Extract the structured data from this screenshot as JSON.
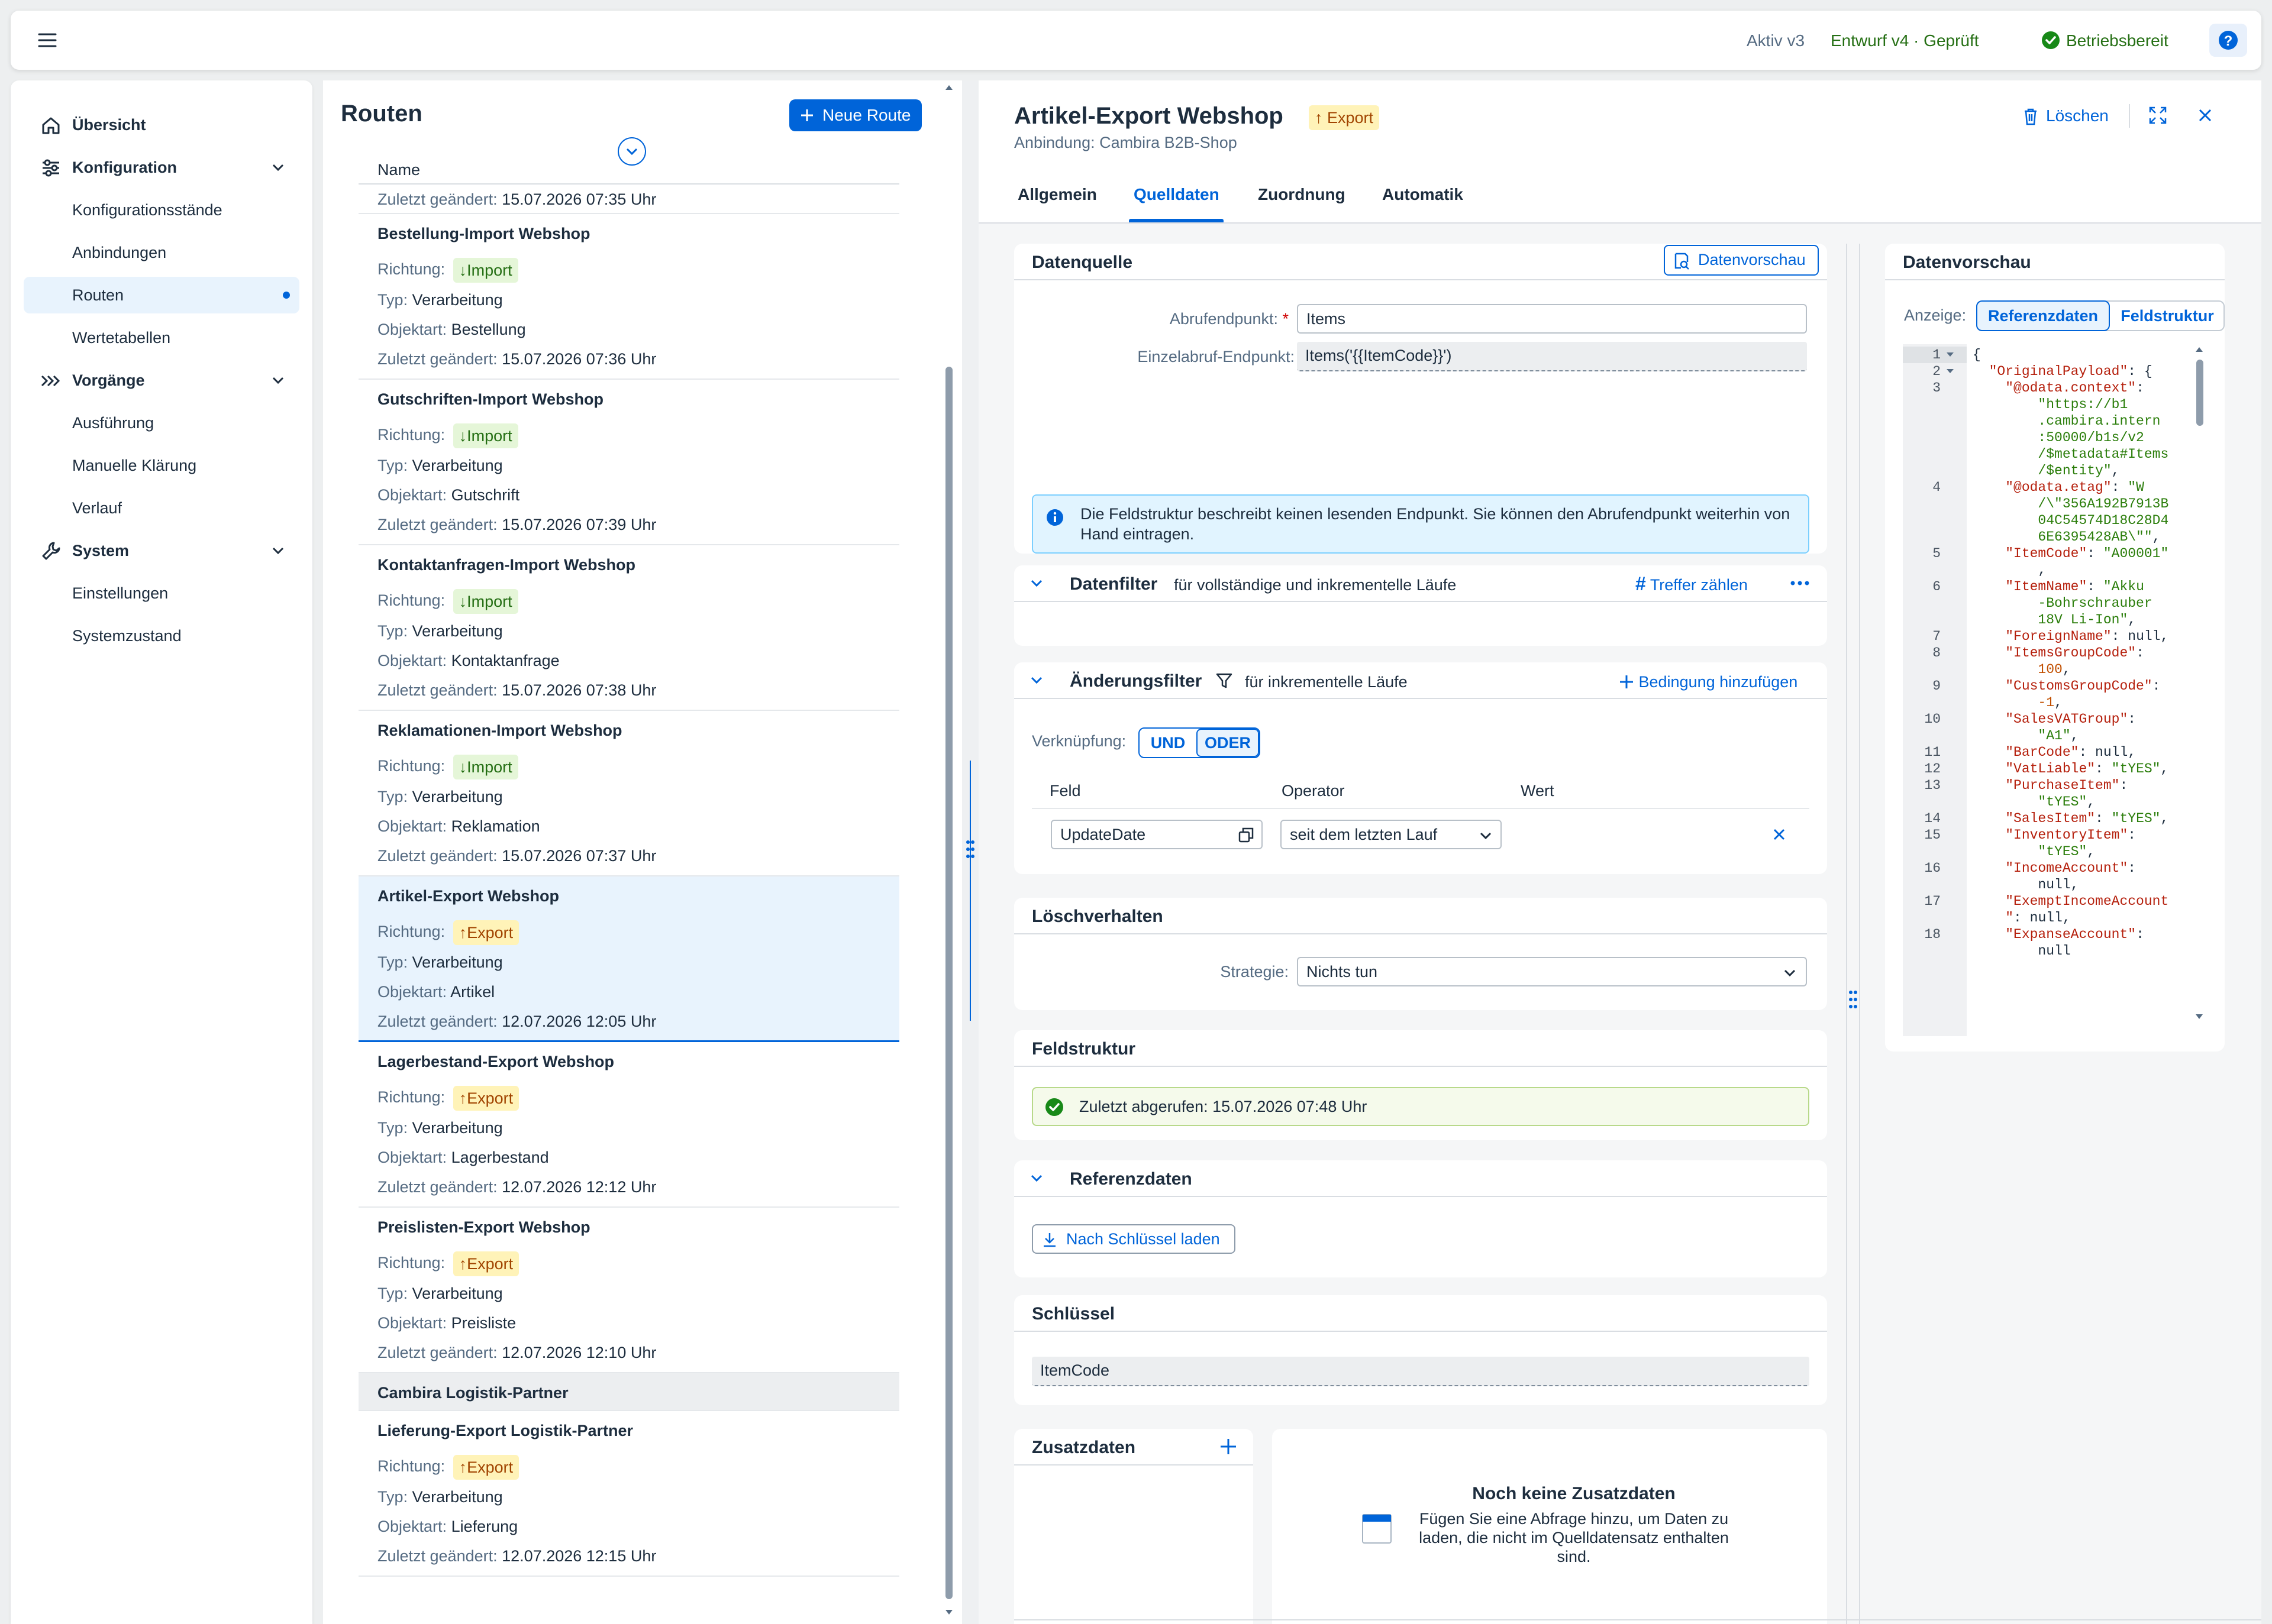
{
  "topbar": {
    "active_version": "Aktiv v3",
    "draft_version": "Entwurf v4 · Geprüft",
    "status": "Betriebsbereit"
  },
  "nav": {
    "items": [
      {
        "label": "Übersicht",
        "icon": "home-icon",
        "level": 0
      },
      {
        "label": "Konfiguration",
        "icon": "settings-sliders-icon",
        "level": 0
      },
      {
        "label": "Konfigurationsstände",
        "level": 1
      },
      {
        "label": "Anbindungen",
        "level": 1
      },
      {
        "label": "Routen",
        "level": 1,
        "selected": true
      },
      {
        "label": "Wertetabellen",
        "level": 1
      },
      {
        "label": "Vorgänge",
        "icon": "process-arrows-icon",
        "level": 0
      },
      {
        "label": "Ausführung",
        "level": 1
      },
      {
        "label": "Manuelle Klärung",
        "level": 1
      },
      {
        "label": "Verlauf",
        "level": 1
      },
      {
        "label": "System",
        "icon": "wrench-icon",
        "level": 0
      },
      {
        "label": "Einstellungen",
        "level": 1
      },
      {
        "label": "Systemzustand",
        "level": 1
      }
    ]
  },
  "routes": {
    "title": "Routen",
    "new_button": "Neue Route",
    "column_header": "Name",
    "labels": {
      "direction": "Richtung:",
      "type": "Typ:",
      "object": "Objektart:",
      "changed": "Zuletzt geändert:"
    },
    "first_row_changed": "15.07.2026 07:35 Uhr",
    "items": [
      {
        "name": "Bestellung-Import Webshop",
        "direction": "Import",
        "type": "Verarbeitung",
        "object": "Bestellung",
        "changed": "15.07.2026 07:36 Uhr"
      },
      {
        "name": "Gutschriften-Import Webshop",
        "direction": "Import",
        "type": "Verarbeitung",
        "object": "Gutschrift",
        "changed": "15.07.2026 07:39 Uhr"
      },
      {
        "name": "Kontaktanfragen-Import Webshop",
        "direction": "Import",
        "type": "Verarbeitung",
        "object": "Kontaktanfrage",
        "changed": "15.07.2026 07:38 Uhr"
      },
      {
        "name": "Reklamationen-Import Webshop",
        "direction": "Import",
        "type": "Verarbeitung",
        "object": "Reklamation",
        "changed": "15.07.2026 07:37 Uhr"
      },
      {
        "name": "Artikel-Export Webshop",
        "direction": "Export",
        "type": "Verarbeitung",
        "object": "Artikel",
        "changed": "12.07.2026 12:05 Uhr",
        "selected": true
      },
      {
        "name": "Lagerbestand-Export Webshop",
        "direction": "Export",
        "type": "Verarbeitung",
        "object": "Lagerbestand",
        "changed": "12.07.2026 12:12 Uhr"
      },
      {
        "name": "Preislisten-Export Webshop",
        "direction": "Export",
        "type": "Verarbeitung",
        "object": "Preisliste",
        "changed": "12.07.2026 12:10 Uhr"
      }
    ],
    "group_header": "Cambira Logistik-Partner",
    "group_items": [
      {
        "name": "Lieferung-Export Logistik-Partner",
        "direction": "Export",
        "type": "Verarbeitung",
        "object": "Lieferung",
        "changed": "12.07.2026 12:15 Uhr"
      }
    ]
  },
  "detail": {
    "title": "Artikel-Export Webshop",
    "direction_badge": "Export",
    "subtitle": "Anbindung: Cambira B2B-Shop",
    "delete_button": "Löschen",
    "tabs": [
      "Allgemein",
      "Quelldaten",
      "Zuordnung",
      "Automatik"
    ],
    "active_tab": "Quelldaten",
    "datasource": {
      "title": "Datenquelle",
      "preview_button": "Datenvorschau",
      "endpoint_label": "Abrufendpunkt:",
      "endpoint_value": "Items",
      "single_label": "Einzelabruf-Endpunkt:",
      "single_value": "Items('{{ItemCode}}')",
      "info": "Die Feldstruktur beschreibt keinen lesenden Endpunkt. Sie können den Abrufendpunkt weiterhin von Hand eintragen."
    },
    "datafilter": {
      "title": "Datenfilter",
      "subtitle": "für vollständige und inkrementelle Läufe",
      "action": "Treffer zählen"
    },
    "changefilter": {
      "title": "Änderungsfilter",
      "subtitle": "für inkrementelle Läufe",
      "action": "Bedingung hinzufügen",
      "link_label": "Verknüpfung:",
      "toggle": [
        "UND",
        "ODER"
      ],
      "active_toggle": "ODER",
      "headers": [
        "Feld",
        "Operator",
        "Wert"
      ],
      "field": "UpdateDate",
      "operator": "seit dem letzten Lauf"
    },
    "delete_behavior": {
      "title": "Löschverhalten",
      "strategy_label": "Strategie:",
      "strategy": "Nichts tun"
    },
    "fieldstructure": {
      "title": "Feldstruktur",
      "status": "Zuletzt abgerufen: 15.07.2026 07:48 Uhr"
    },
    "referencedata": {
      "title": "Referenzdaten",
      "button": "Nach Schlüssel laden"
    },
    "key": {
      "title": "Schlüssel",
      "value": "ItemCode"
    },
    "extradata": {
      "title": "Zusatzdaten",
      "empty_title": "Noch keine Zusatzdaten",
      "empty_text": "Fügen Sie eine Abfrage hinzu, um Daten zu laden, die nicht im Quelldatensatz enthalten sind."
    },
    "preview": {
      "title": "Datenvorschau",
      "display_label": "Anzeige:",
      "options": [
        "Referenzdaten",
        "Feldstruktur"
      ],
      "active_option": "Referenzdaten",
      "lines": [
        {
          "n": "1",
          "fold": true,
          "t": [
            [
              "p",
              "{"
            ]
          ]
        },
        {
          "n": "2",
          "fold": true,
          "t": [
            [
              "p",
              "  "
            ],
            [
              "k",
              "\"OriginalPayload\""
            ],
            [
              "p",
              ": {"
            ]
          ]
        },
        {
          "n": "3",
          "t": [
            [
              "p",
              "    "
            ],
            [
              "k",
              "\"@odata.context\""
            ],
            [
              "p",
              ":"
            ]
          ]
        },
        {
          "t": [
            [
              "p",
              "        "
            ],
            [
              "v",
              "\"https://b1"
            ]
          ]
        },
        {
          "t": [
            [
              "p",
              "        "
            ],
            [
              "v",
              ".cambira.intern"
            ]
          ]
        },
        {
          "t": [
            [
              "p",
              "        "
            ],
            [
              "v",
              ":50000/b1s/v2"
            ]
          ]
        },
        {
          "t": [
            [
              "p",
              "        "
            ],
            [
              "v",
              "/$metadata#Items"
            ]
          ]
        },
        {
          "t": [
            [
              "p",
              "        "
            ],
            [
              "v",
              "/$entity\""
            ],
            [
              "p",
              ","
            ]
          ]
        },
        {
          "n": "4",
          "t": [
            [
              "p",
              "    "
            ],
            [
              "k",
              "\"@odata.etag\""
            ],
            [
              "p",
              ": "
            ],
            [
              "v",
              "\"W"
            ]
          ]
        },
        {
          "t": [
            [
              "p",
              "        "
            ],
            [
              "v",
              "/\\\"356A192B7913B"
            ]
          ]
        },
        {
          "t": [
            [
              "p",
              "        "
            ],
            [
              "v",
              "04C54574D18C28D4"
            ]
          ]
        },
        {
          "t": [
            [
              "p",
              "        "
            ],
            [
              "v",
              "6E6395428AB\\\"\""
            ],
            [
              "p",
              ","
            ]
          ]
        },
        {
          "n": "5",
          "t": [
            [
              "p",
              "    "
            ],
            [
              "k",
              "\"ItemCode\""
            ],
            [
              "p",
              ": "
            ],
            [
              "v",
              "\"A00001\""
            ]
          ]
        },
        {
          "t": [
            [
              "p",
              "        ,"
            ]
          ]
        },
        {
          "n": "6",
          "t": [
            [
              "p",
              "    "
            ],
            [
              "k",
              "\"ItemName\""
            ],
            [
              "p",
              ": "
            ],
            [
              "v",
              "\"Akku"
            ]
          ]
        },
        {
          "t": [
            [
              "p",
              "        "
            ],
            [
              "v",
              "-Bohrschrauber"
            ]
          ]
        },
        {
          "t": [
            [
              "p",
              "        "
            ],
            [
              "v",
              "18V Li-Ion\""
            ],
            [
              "p",
              ","
            ]
          ]
        },
        {
          "n": "7",
          "t": [
            [
              "p",
              "    "
            ],
            [
              "k",
              "\"ForeignName\""
            ],
            [
              "p",
              ": null,"
            ]
          ]
        },
        {
          "n": "8",
          "t": [
            [
              "p",
              "    "
            ],
            [
              "k",
              "\"ItemsGroupCode\""
            ],
            [
              "p",
              ":"
            ]
          ]
        },
        {
          "t": [
            [
              "p",
              "        "
            ],
            [
              "n",
              "100"
            ],
            [
              "p",
              ","
            ]
          ]
        },
        {
          "n": "9",
          "t": [
            [
              "p",
              "    "
            ],
            [
              "k",
              "\"CustomsGroupCode\""
            ],
            [
              "p",
              ":"
            ]
          ]
        },
        {
          "t": [
            [
              "p",
              "        "
            ],
            [
              "n",
              "-1"
            ],
            [
              "p",
              ","
            ]
          ]
        },
        {
          "n": "10",
          "t": [
            [
              "p",
              "    "
            ],
            [
              "k",
              "\"SalesVATGroup\""
            ],
            [
              "p",
              ":"
            ]
          ]
        },
        {
          "t": [
            [
              "p",
              "        "
            ],
            [
              "v",
              "\"A1\""
            ],
            [
              "p",
              ","
            ]
          ]
        },
        {
          "n": "11",
          "t": [
            [
              "p",
              "    "
            ],
            [
              "k",
              "\"BarCode\""
            ],
            [
              "p",
              ": null,"
            ]
          ]
        },
        {
          "n": "12",
          "t": [
            [
              "p",
              "    "
            ],
            [
              "k",
              "\"VatLiable\""
            ],
            [
              "p",
              ": "
            ],
            [
              "v",
              "\"tYES\""
            ],
            [
              "p",
              ","
            ]
          ]
        },
        {
          "n": "13",
          "t": [
            [
              "p",
              "    "
            ],
            [
              "k",
              "\"PurchaseItem\""
            ],
            [
              "p",
              ":"
            ]
          ]
        },
        {
          "t": [
            [
              "p",
              "        "
            ],
            [
              "v",
              "\"tYES\""
            ],
            [
              "p",
              ","
            ]
          ]
        },
        {
          "n": "14",
          "t": [
            [
              "p",
              "    "
            ],
            [
              "k",
              "\"SalesItem\""
            ],
            [
              "p",
              ": "
            ],
            [
              "v",
              "\"tYES\""
            ],
            [
              "p",
              ","
            ]
          ]
        },
        {
          "n": "15",
          "t": [
            [
              "p",
              "    "
            ],
            [
              "k",
              "\"InventoryItem\""
            ],
            [
              "p",
              ":"
            ]
          ]
        },
        {
          "t": [
            [
              "p",
              "        "
            ],
            [
              "v",
              "\"tYES\""
            ],
            [
              "p",
              ","
            ]
          ]
        },
        {
          "n": "16",
          "t": [
            [
              "p",
              "    "
            ],
            [
              "k",
              "\"IncomeAccount\""
            ],
            [
              "p",
              ":"
            ]
          ]
        },
        {
          "t": [
            [
              "p",
              "        null,"
            ]
          ]
        },
        {
          "n": "17",
          "t": [
            [
              "p",
              "    "
            ],
            [
              "k",
              "\"ExemptIncomeAccount"
            ]
          ]
        },
        {
          "t": [
            [
              "p",
              "    "
            ],
            [
              "k",
              "\""
            ],
            [
              "p",
              ": null,"
            ]
          ]
        },
        {
          "n": "18",
          "t": [
            [
              "p",
              "    "
            ],
            [
              "k",
              "\"ExpanseAccount\""
            ],
            [
              "p",
              ":"
            ]
          ]
        },
        {
          "t": [
            [
              "p",
              "        null"
            ]
          ]
        }
      ]
    }
  },
  "colors": {
    "accent": "#0064d9",
    "selected_bg": "#e8f3fd",
    "import_bg": "#e5f6d8",
    "export_bg": "#fff3b8",
    "ok": "#188918"
  }
}
